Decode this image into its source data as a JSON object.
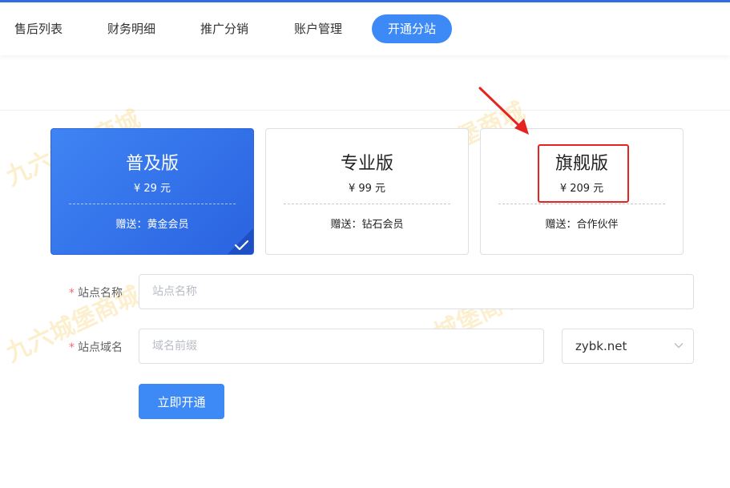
{
  "nav": {
    "items": [
      {
        "label": "售后列表",
        "active": false
      },
      {
        "label": "财务明细",
        "active": false
      },
      {
        "label": "推广分销",
        "active": false
      },
      {
        "label": "账户管理",
        "active": false
      },
      {
        "label": "开通分站",
        "active": true
      }
    ]
  },
  "plans": [
    {
      "name": "普及版",
      "price": "¥ 29 元",
      "gift": "赠送：黄金会员",
      "selected": true
    },
    {
      "name": "专业版",
      "price": "¥ 99 元",
      "gift": "赠送：钻石会员",
      "selected": false
    },
    {
      "name": "旗舰版",
      "price": "¥ 209 元",
      "gift": "赠送：合作伙伴",
      "selected": false
    }
  ],
  "form": {
    "required_mark": "*",
    "site_name": {
      "label": "站点名称",
      "placeholder": "站点名称",
      "value": ""
    },
    "site_domain": {
      "label": "站点域名",
      "placeholder": "域名前缀",
      "value": ""
    },
    "domain_suffix": {
      "selected": "zybk.net"
    },
    "submit_label": "立即开通"
  },
  "watermark": "九六城堡商城",
  "colors": {
    "accent": "#3d8af7",
    "annotation_red": "#e5241f",
    "required": "#f56c6c"
  }
}
